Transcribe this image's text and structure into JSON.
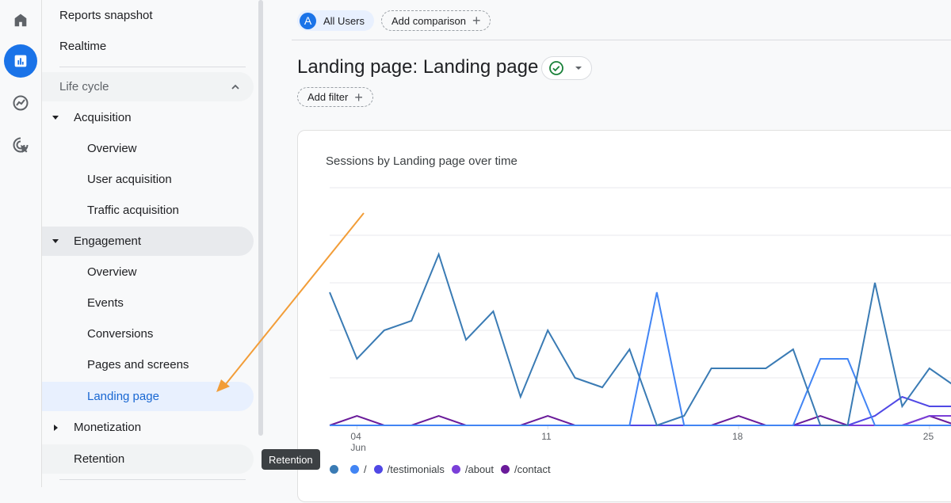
{
  "rail": {
    "items": [
      {
        "name": "home",
        "icon": "home-icon",
        "active": false
      },
      {
        "name": "reports",
        "icon": "bar-chart-icon",
        "active": true
      },
      {
        "name": "explore",
        "icon": "explore-icon",
        "active": false
      },
      {
        "name": "advertising",
        "icon": "advertising-icon",
        "active": false
      }
    ]
  },
  "sidebar": {
    "reports_snapshot": "Reports snapshot",
    "realtime": "Realtime",
    "lifecycle": "Life cycle",
    "acquisition": "Acquisition",
    "acq_overview": "Overview",
    "user_acquisition": "User acquisition",
    "traffic_acquisition": "Traffic acquisition",
    "engagement": "Engagement",
    "eng_overview": "Overview",
    "events": "Events",
    "conversions": "Conversions",
    "pages_and_screens": "Pages and screens",
    "landing_page": "Landing page",
    "monetization": "Monetization",
    "retention": "Retention"
  },
  "tooltip": "Retention",
  "header": {
    "segment_avatar": "A",
    "segment_label": "All Users",
    "add_comparison": "Add comparison",
    "title": "Landing page: Landing page",
    "add_filter": "Add filter"
  },
  "colors": {
    "accent": "#1a73e8",
    "annotation_arrow": "#f29d38",
    "status_check": "#188038"
  },
  "chart_data": {
    "type": "line",
    "title": "Sessions by Landing page over time",
    "xlabel": "",
    "ylabel": "",
    "x_ticks": [
      {
        "day": 4,
        "label": "04",
        "sublabel": "Jun"
      },
      {
        "day": 11,
        "label": "11",
        "sublabel": ""
      },
      {
        "day": 18,
        "label": "18",
        "sublabel": ""
      },
      {
        "day": 25,
        "label": "25",
        "sublabel": ""
      }
    ],
    "x": [
      3,
      4,
      5,
      6,
      7,
      8,
      9,
      10,
      11,
      12,
      13,
      14,
      15,
      16,
      17,
      18,
      19,
      20,
      21,
      22,
      23,
      24,
      25,
      26
    ],
    "ylim": [
      0,
      25
    ],
    "y_gridlines": [
      0,
      5,
      10,
      15,
      20,
      25
    ],
    "grid": true,
    "legend_position": "bottom-left",
    "series": [
      {
        "name": "",
        "color": "#3a7bb4",
        "values": [
          14,
          7,
          10,
          11,
          18,
          9,
          12,
          3,
          10,
          5,
          4,
          8,
          0,
          1,
          6,
          6,
          6,
          8,
          0,
          0,
          15,
          2,
          6,
          4
        ]
      },
      {
        "name": "/",
        "color": "#4285f4",
        "values": [
          0,
          0,
          0,
          0,
          0,
          0,
          0,
          0,
          0,
          0,
          0,
          0,
          14,
          0,
          0,
          0,
          0,
          0,
          7,
          7,
          0,
          0,
          0,
          0
        ]
      },
      {
        "name": "/testimonials",
        "color": "#5048e5",
        "values": [
          0,
          0,
          0,
          0,
          0,
          0,
          0,
          0,
          0,
          0,
          0,
          0,
          0,
          0,
          0,
          0,
          0,
          0,
          0,
          0,
          1,
          3,
          2,
          2
        ]
      },
      {
        "name": "/about",
        "color": "#7a3fd8",
        "values": [
          0,
          0,
          0,
          0,
          0,
          0,
          0,
          0,
          0,
          0,
          0,
          0,
          0,
          0,
          0,
          0,
          0,
          0,
          0,
          0,
          0,
          0,
          1,
          1
        ]
      },
      {
        "name": "/contact",
        "color": "#6a1b9a",
        "values": [
          0,
          1,
          0,
          0,
          1,
          0,
          0,
          0,
          1,
          0,
          0,
          0,
          0,
          0,
          0,
          1,
          0,
          0,
          1,
          0,
          0,
          0,
          1,
          0
        ]
      }
    ]
  }
}
